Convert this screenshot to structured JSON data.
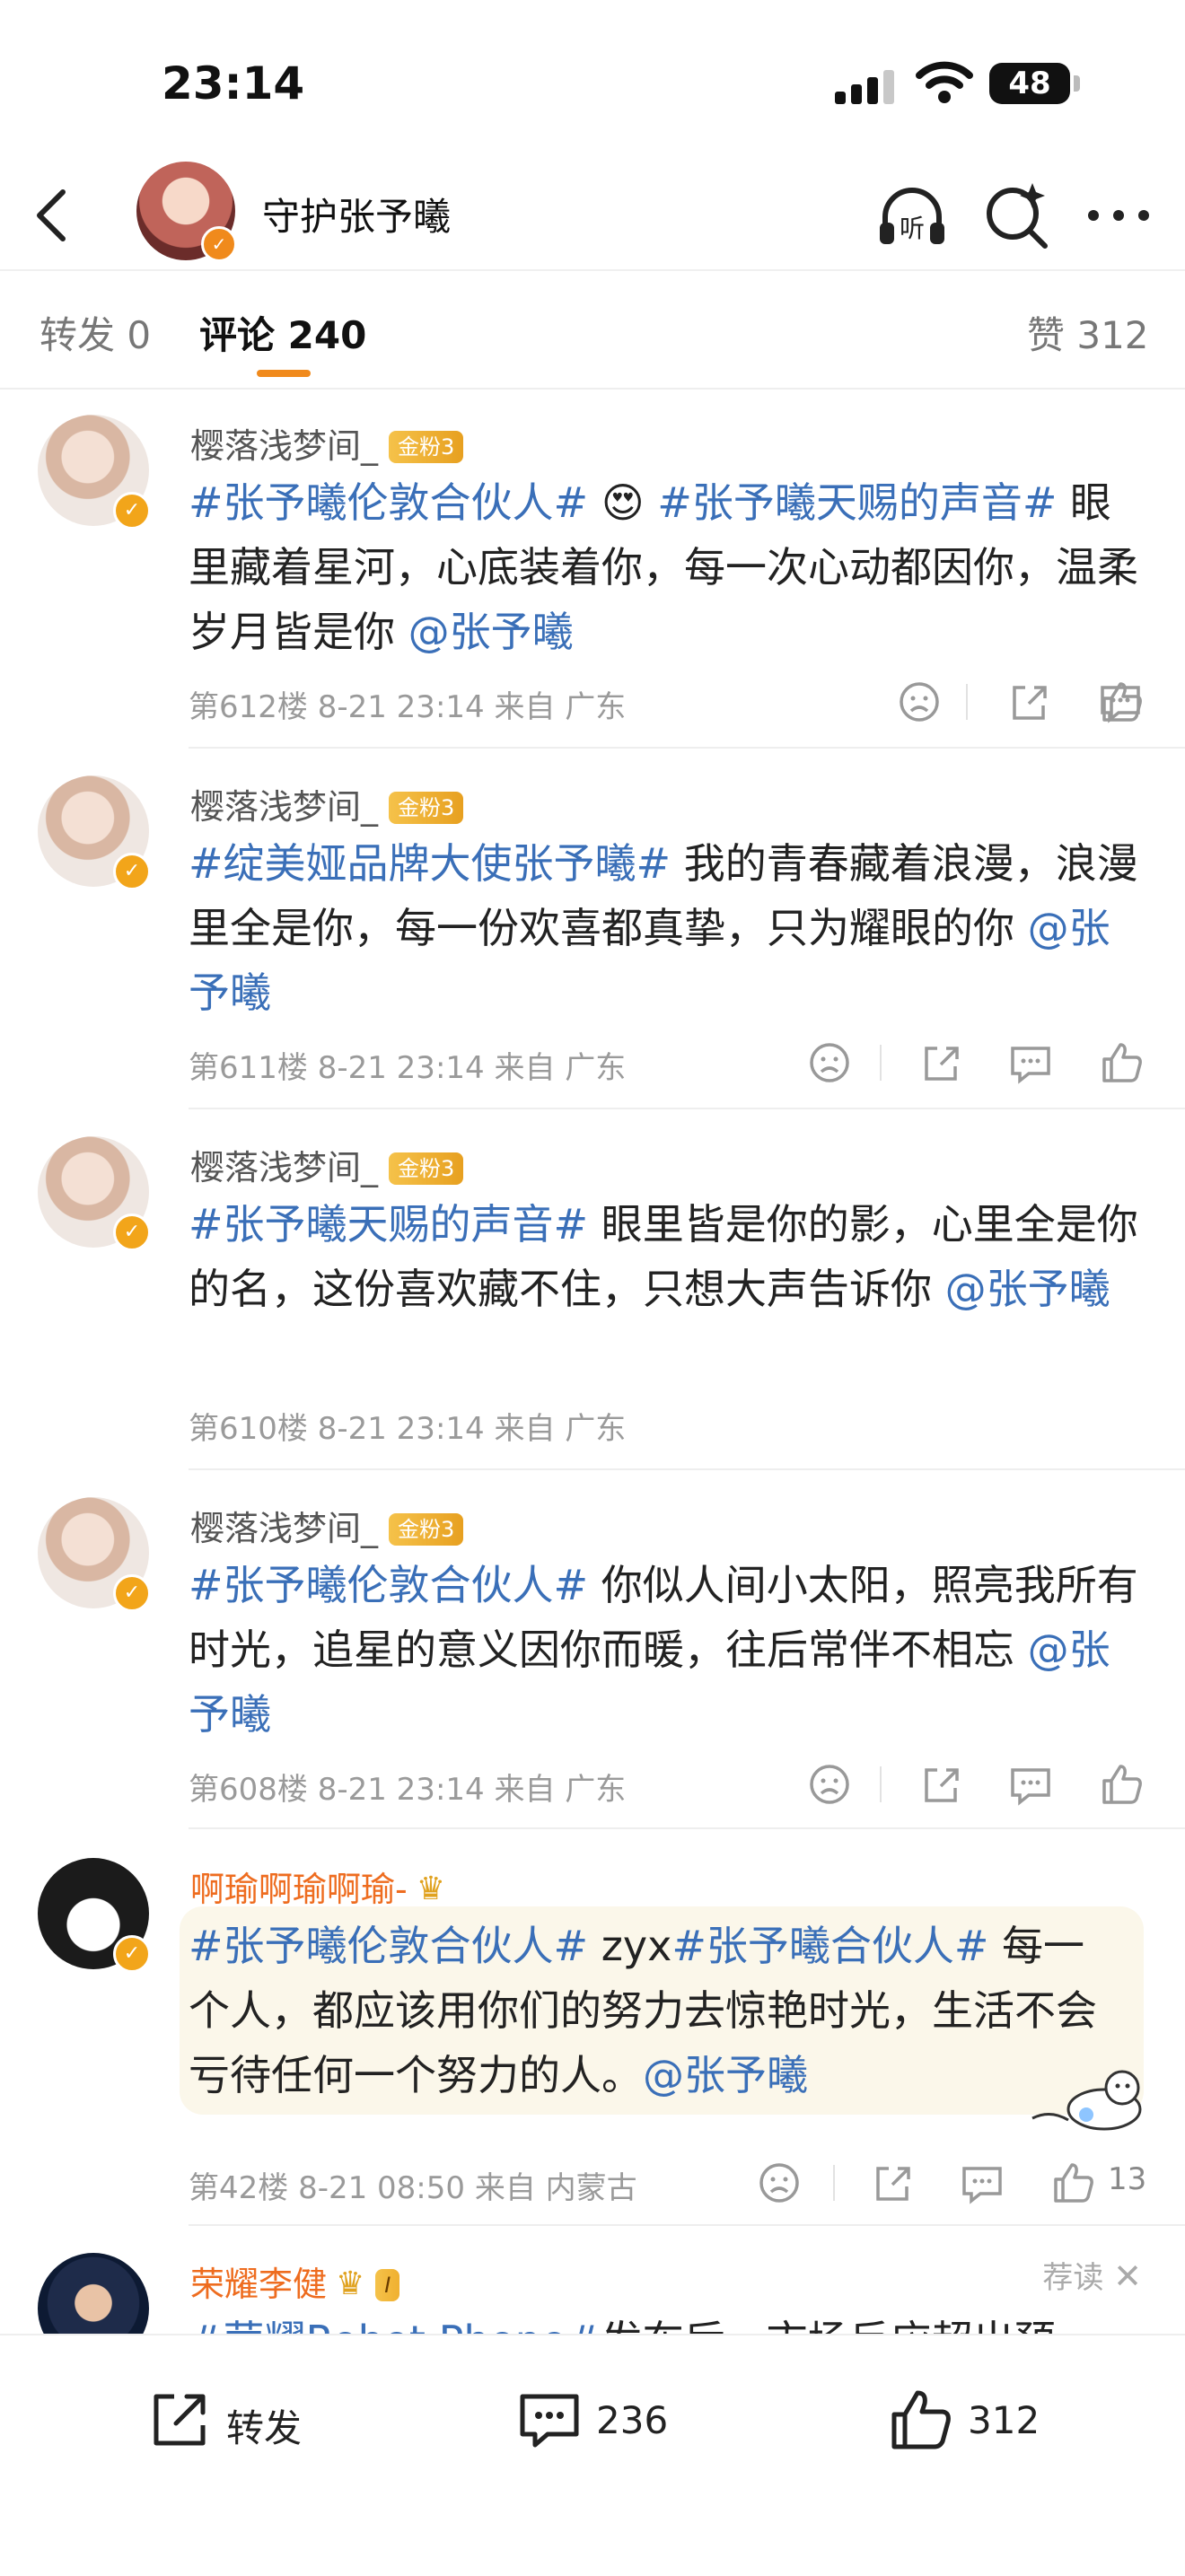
{
  "status": {
    "time": "23:14",
    "battery": "48"
  },
  "nav": {
    "title": "守护张予曦"
  },
  "tabs": {
    "repost": "转发 0",
    "comments": "评论 240",
    "likes": "赞 312"
  },
  "comments": [
    {
      "name": "樱落浅梦间_",
      "badge": "金粉3",
      "text_parts": [
        "#张予曦伦敦合伙人#",
        " 😍 ",
        "#张予曦天赐的声音#",
        " 眼里藏着星河，心底装着你，每一次心动都因你，温柔岁月皆是你 ",
        "@张予曦"
      ],
      "meta": "第612楼 8-21 23:14 来自 广东"
    },
    {
      "name": "樱落浅梦间_",
      "badge": "金粉3",
      "text_parts": [
        "#绽美娅品牌大使张予曦#",
        " 我的青春藏着浪漫，浪漫里全是你，每一份欢喜都真挚，只为耀眼的你 ",
        "@张予曦"
      ],
      "meta": "第611楼 8-21 23:14 来自 广东"
    },
    {
      "name": "樱落浅梦间_",
      "badge": "金粉3",
      "text_parts": [
        "#张予曦天赐的声音#",
        " 眼里皆是你的影，心里全是你的名，这份喜欢藏不住，只想大声告诉你 ",
        "@张予曦"
      ],
      "meta": "第610楼 8-21 23:14 来自 广东"
    },
    {
      "name": "樱落浅梦间_",
      "badge": "金粉3",
      "text_parts": [
        "#张予曦伦敦合伙人#",
        " 你似人间小太阳，照亮我所有时光，追星的意义因你而暖，往后常伴不相忘 ",
        "@张予曦"
      ],
      "meta": "第608楼 8-21 23:14 来自 广东"
    },
    {
      "name": "啊瑜啊瑜啊瑜-",
      "text_parts": [
        "#张予曦伦敦合伙人#",
        " zyx",
        "#张予曦合伙人#",
        " 每一个人，都应该用你们的努力去惊艳时光，生活不会亏待任何一个努力的人。",
        "@张予曦"
      ],
      "meta": "第42楼 8-21 08:50 来自 内蒙古",
      "likes": "13"
    },
    {
      "name": "荣耀李健",
      "level": "I",
      "recommend": "荐读",
      "text_parts": [
        "#荣耀Robot Phone#",
        "发布后，市场反应超出预"
      ]
    }
  ],
  "bottom": {
    "repost": "转发",
    "comments": "236",
    "likes": "312"
  },
  "colors": {
    "accent": "#f08a1c",
    "link": "#3a6fb8",
    "name_orange": "#ee6c1f"
  }
}
